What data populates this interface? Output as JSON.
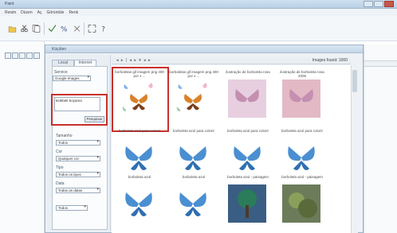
{
  "window": {
    "title": "Paint"
  },
  "menu": [
    "Resim",
    "Düzen",
    "Aç",
    "Görüntüle",
    "Renk"
  ],
  "dialog": {
    "title": "Küçülen"
  },
  "tabs": [
    "Local",
    "Internet"
  ],
  "left": {
    "service_label": "Service",
    "service_value": "Google Images",
    "search_text": "kelebek boyama",
    "search_button": "Pesquisar",
    "filters": [
      "Tamanho",
      "Cor",
      "Tipo",
      "Data"
    ],
    "filter_values": [
      "Todos",
      "Qualquer cor",
      "Todos os tipos",
      "Todas as datas",
      "Todos"
    ]
  },
  "nav": {
    "count": "Images found: 1000"
  },
  "results": [
    {
      "caption": "borboletas gif imagem png 400 por x ...",
      "kind": "butterflies",
      "selected": true
    },
    {
      "caption": "borboletas gif imagem png 400 por x ...",
      "kind": "butterflies",
      "selected": false
    },
    {
      "caption": "ilustração de borboleta rosa",
      "kind": "pink",
      "selected": false
    },
    {
      "caption": "ilustração de borboleta rosa 2005",
      "kind": "pink2",
      "selected": false
    },
    {
      "caption": "borboleta azul para colorir",
      "kind": "blue",
      "selected": false
    },
    {
      "caption": "borboleta azul para colorir",
      "kind": "blue",
      "selected": false
    },
    {
      "caption": "borboleta azul para colorir",
      "kind": "blue",
      "selected": false
    },
    {
      "caption": "borboleta azul para colorir",
      "kind": "blue",
      "selected": false
    },
    {
      "caption": "borboleta azul",
      "kind": "blue",
      "selected": false
    },
    {
      "caption": "borboleta azul",
      "kind": "blue",
      "selected": false
    },
    {
      "caption": "borboleta azul - paisagem",
      "kind": "tree",
      "selected": false
    },
    {
      "caption": "borboleta azul - paisagem",
      "kind": "forest",
      "selected": false
    }
  ],
  "colors": {
    "highlight": "#c8302c"
  }
}
